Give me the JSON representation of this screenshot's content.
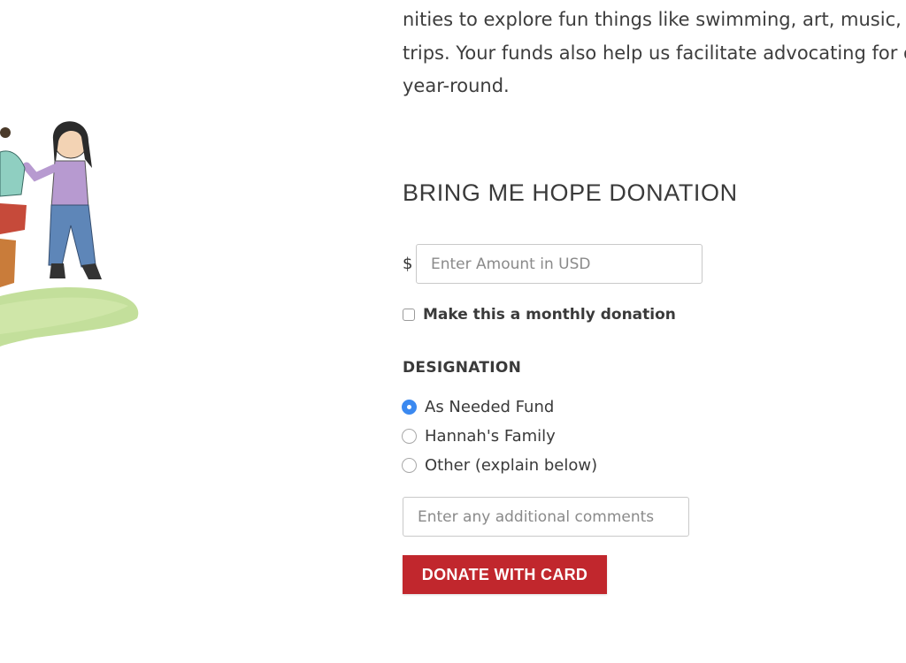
{
  "intro": {
    "lines": [
      "nities to explore fun things like swimming, art, music, and",
      "trips. Your funds also help us facilitate advocating for or",
      "year-round."
    ]
  },
  "form": {
    "title": "BRING ME HOPE DONATION",
    "currency_symbol": "$",
    "amount": {
      "value": "",
      "placeholder": "Enter Amount in USD"
    },
    "monthly": {
      "label": "Make this a monthly donation",
      "checked": false
    },
    "designation": {
      "label": "DESIGNATION",
      "selected": 0,
      "options": [
        "As Needed Fund",
        "Hannah's Family",
        "Other (explain below)"
      ]
    },
    "comments": {
      "value": "",
      "placeholder": "Enter any additional comments"
    },
    "submit_label": "DONATE WITH CARD"
  },
  "colors": {
    "accent_radio": "#3b89f0",
    "donate_button": "#c1272d"
  }
}
